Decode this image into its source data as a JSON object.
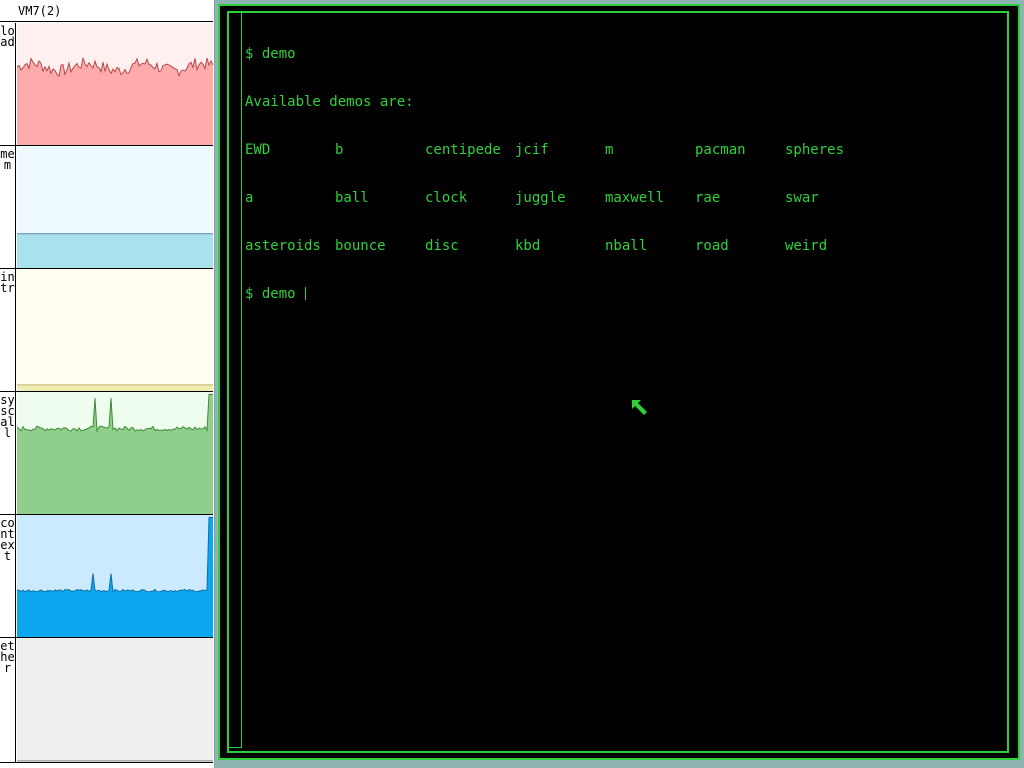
{
  "stats": {
    "title": "VM7(2)",
    "graphs": [
      {
        "label": "load",
        "fill": "#ffabab",
        "line": "#b34a4a",
        "bg": "#fff0f0"
      },
      {
        "label": "mem",
        "fill": "#a9e2ec",
        "line": "#5a80b8",
        "bg": "#eefaff"
      },
      {
        "label": "intr",
        "fill": "#f1ecb2",
        "line": "#b9b46a",
        "bg": "#fffef0"
      },
      {
        "label": "syscall",
        "fill": "#8fcf8b",
        "line": "#3f8a3a",
        "bg": "#eefdee"
      },
      {
        "label": "context",
        "fill": "#0aa7ef",
        "line": "#0f6fa8",
        "bg": "#cbeaff"
      },
      {
        "label": "ether",
        "fill": "#d9d9d9",
        "line": "#999999",
        "bg": "#efefef"
      }
    ]
  },
  "terminal": {
    "command_line": "$ demo",
    "header": "Available demos are:",
    "demo_rows": [
      [
        "EWD",
        "b",
        "centipede",
        "jcif",
        "m",
        "pacman",
        "spheres"
      ],
      [
        "a",
        "ball",
        "clock",
        "juggle",
        "maxwell",
        "rae",
        "swar"
      ],
      [
        "asteroids",
        "bounce",
        "disc",
        "kbd",
        "nball",
        "road",
        "weird"
      ]
    ],
    "prompt_line": "$ demo ",
    "text_color": "#2fd13b"
  },
  "colors": {
    "desktop": "#8fb5b3",
    "window_border": "#2fcf3a",
    "terminal_bg": "#000000"
  }
}
